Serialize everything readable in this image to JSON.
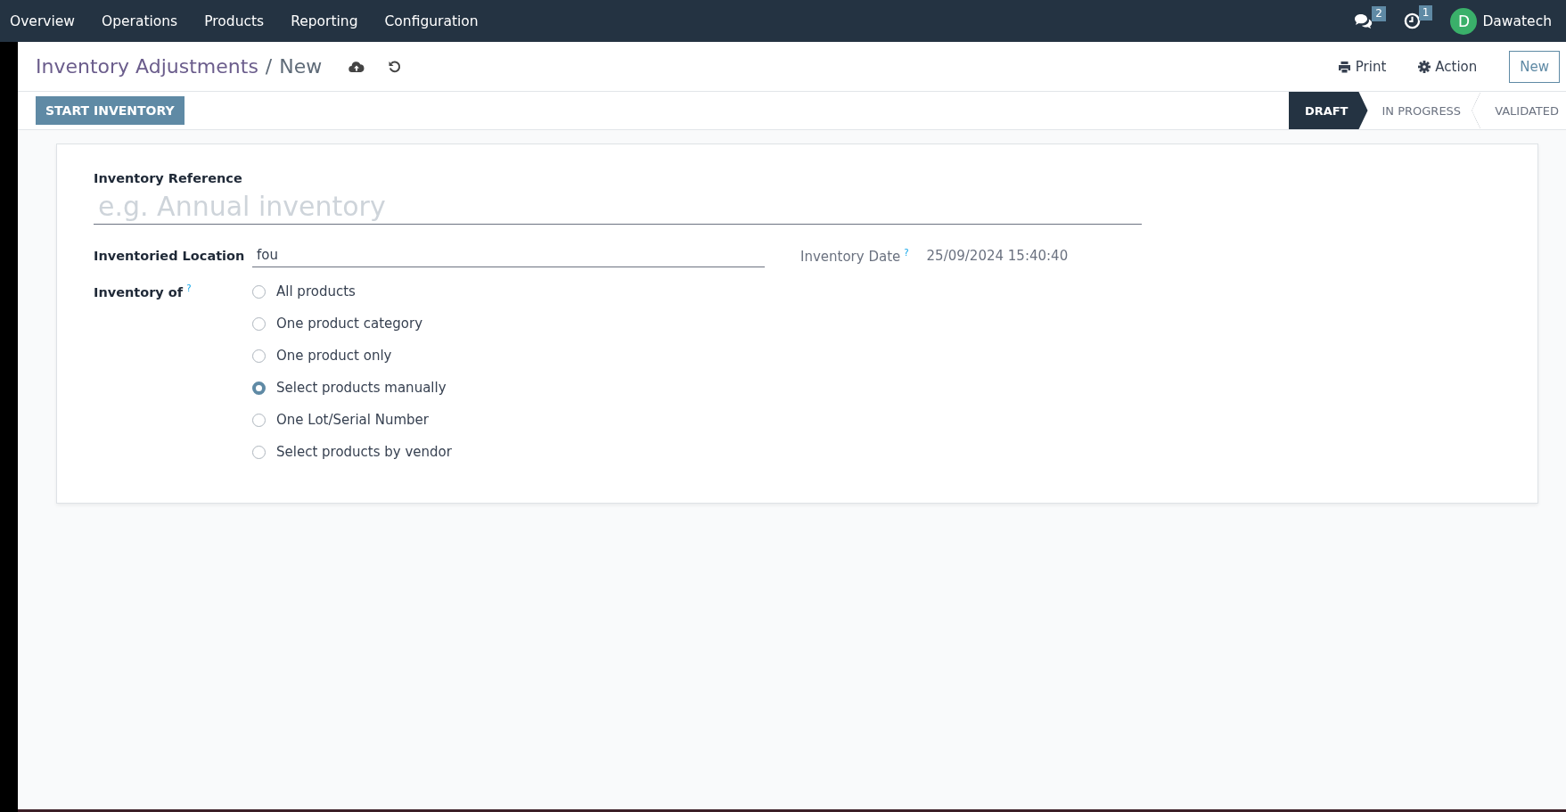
{
  "navbar": {
    "menu": [
      "Overview",
      "Operations",
      "Products",
      "Reporting",
      "Configuration"
    ],
    "messages_count": "2",
    "activities_count": "1",
    "user_initial": "D",
    "user_name": "Dawatech"
  },
  "breadcrumb": {
    "parent": "Inventory Adjustments",
    "separator": "/",
    "current": "New"
  },
  "actions": {
    "print": "Print",
    "action": "Action",
    "new": "New"
  },
  "start_button": "START INVENTORY",
  "stages": [
    {
      "label": "DRAFT",
      "selected": true
    },
    {
      "label": "IN PROGRESS",
      "selected": false
    },
    {
      "label": "VALIDATED",
      "selected": false
    }
  ],
  "form": {
    "reference_label": "Inventory Reference",
    "reference_placeholder": "e.g. Annual inventory",
    "location_label": "Inventoried Location",
    "location_value": "fou",
    "date_label": "Inventory Date",
    "date_help": "?",
    "date_value": "25/09/2024 15:40:40",
    "inventory_of_label": "Inventory of",
    "inventory_of_help": "?",
    "options": [
      {
        "label": "All products",
        "selected": false
      },
      {
        "label": "One product category",
        "selected": false
      },
      {
        "label": "One product only",
        "selected": false
      },
      {
        "label": "Select products manually",
        "selected": true
      },
      {
        "label": "One Lot/Serial Number",
        "selected": false
      },
      {
        "label": "Select products by vendor",
        "selected": false
      }
    ]
  }
}
